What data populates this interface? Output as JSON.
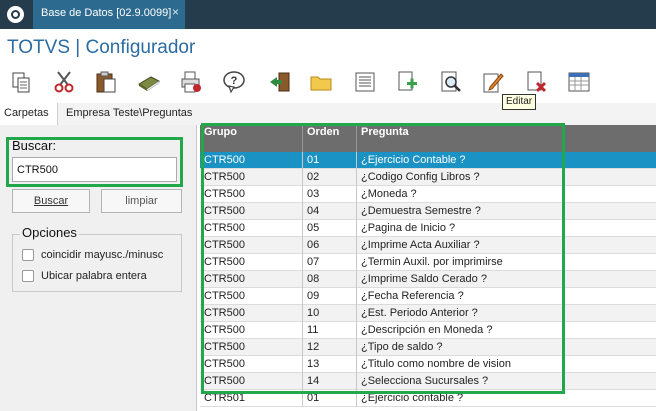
{
  "topbar": {
    "tab_label": "Base de Datos [02.9.0099]",
    "close_glyph": "×"
  },
  "app_title": "TOTVS | Configurador",
  "toolbar": {
    "buttons": [
      {
        "icon": "copy-icon"
      },
      {
        "icon": "cut-icon"
      },
      {
        "icon": "paste-icon"
      },
      {
        "icon": "book-icon"
      },
      {
        "icon": "printer-icon"
      },
      {
        "icon": "help-icon"
      },
      {
        "icon": "exit-icon"
      },
      {
        "icon": "folder-icon"
      },
      {
        "icon": "list-icon"
      },
      {
        "icon": "add-document-icon"
      },
      {
        "icon": "preview-icon"
      },
      {
        "icon": "edit-icon"
      },
      {
        "icon": "delete-document-icon"
      },
      {
        "icon": "calendar-icon"
      }
    ],
    "tooltip": "Editar"
  },
  "section_tabs": {
    "carpetas": "Carpetas",
    "breadcrumb": "Empresa Teste\\Preguntas"
  },
  "search": {
    "label": "Buscar:",
    "value": "CTR500",
    "buscar_label": "Buscar",
    "limpiar_label": "limpiar"
  },
  "options": {
    "legend": "Opciones",
    "items": [
      {
        "label": "coincidir mayusc./minusc",
        "checked": false
      },
      {
        "label": "Ubicar palabra entera",
        "checked": false
      }
    ]
  },
  "grid": {
    "columns": [
      "Grupo",
      "Orden",
      "Pregunta"
    ],
    "rows": [
      {
        "grupo": "CTR500",
        "orden": "01",
        "pregunta": "¿Ejercicio Contable ?"
      },
      {
        "grupo": "CTR500",
        "orden": "02",
        "pregunta": "¿Codigo Config Libros ?"
      },
      {
        "grupo": "CTR500",
        "orden": "03",
        "pregunta": "¿Moneda ?"
      },
      {
        "grupo": "CTR500",
        "orden": "04",
        "pregunta": "¿Demuestra Semestre ?"
      },
      {
        "grupo": "CTR500",
        "orden": "05",
        "pregunta": "¿Pagina de Inicio ?"
      },
      {
        "grupo": "CTR500",
        "orden": "06",
        "pregunta": "¿Imprime Acta Auxiliar ?"
      },
      {
        "grupo": "CTR500",
        "orden": "07",
        "pregunta": "¿Termin Auxil. por imprimirse"
      },
      {
        "grupo": "CTR500",
        "orden": "08",
        "pregunta": "¿Imprime Saldo Cerado ?"
      },
      {
        "grupo": "CTR500",
        "orden": "09",
        "pregunta": "¿Fecha Referencia ?"
      },
      {
        "grupo": "CTR500",
        "orden": "10",
        "pregunta": "¿Est. Periodo Anterior ?"
      },
      {
        "grupo": "CTR500",
        "orden": "11",
        "pregunta": "¿Descripción en Moneda ?"
      },
      {
        "grupo": "CTR500",
        "orden": "12",
        "pregunta": "¿Tipo de saldo ?"
      },
      {
        "grupo": "CTR500",
        "orden": "13",
        "pregunta": "¿Titulo como nombre de vision"
      },
      {
        "grupo": "CTR500",
        "orden": "14",
        "pregunta": "¿Selecciona Sucursales ?"
      },
      {
        "grupo": "CTR501",
        "orden": "01",
        "pregunta": "¿Ejercicio contable ?"
      }
    ],
    "selected_index": 0
  },
  "colors": {
    "highlight": "#22a84a",
    "selected_row": "#1a92c4",
    "title": "#2b6ca3",
    "topbar": "#243c4c"
  }
}
